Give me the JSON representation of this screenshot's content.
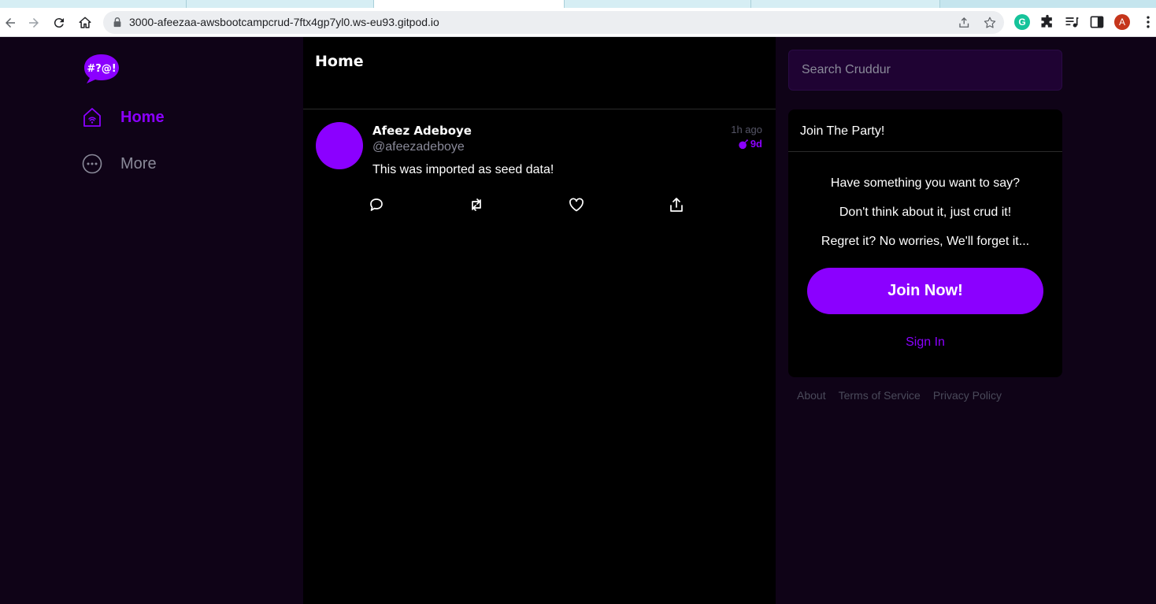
{
  "browser": {
    "url": "3000-afeezaa-awsbootcampcrud-7ftx4gp7yl0.ws-eu93.gitpod.io",
    "profile_initial": "A",
    "grammarly_letter": "G"
  },
  "app": {
    "nav": {
      "home_label": "Home",
      "more_label": "More"
    },
    "feed": {
      "title": "Home",
      "activity": {
        "display_name": "Afeez Adeboye",
        "handle": "@afeezadeboye",
        "message": "This was imported as seed data!",
        "time_ago": "1h ago",
        "expires_in": "9d"
      }
    },
    "search": {
      "placeholder": "Search Cruddur"
    },
    "join": {
      "title": "Join The Party!",
      "line1": "Have something you want to say?",
      "line2": "Don't think about it, just crud it!",
      "line3": "Regret it? No worries, We'll forget it...",
      "button": "Join Now!",
      "signin": "Sign In"
    },
    "footer": {
      "about": "About",
      "terms": "Terms of Service",
      "privacy": "Privacy Policy"
    },
    "colors": {
      "accent": "#8b00ff",
      "page_bg": "#0f0317",
      "feed_bg": "#000000",
      "search_bg": "#1f0333"
    },
    "icons": [
      "home-icon",
      "more-icon",
      "reply-icon",
      "repost-icon",
      "like-icon",
      "share-icon",
      "bomb-icon"
    ]
  }
}
